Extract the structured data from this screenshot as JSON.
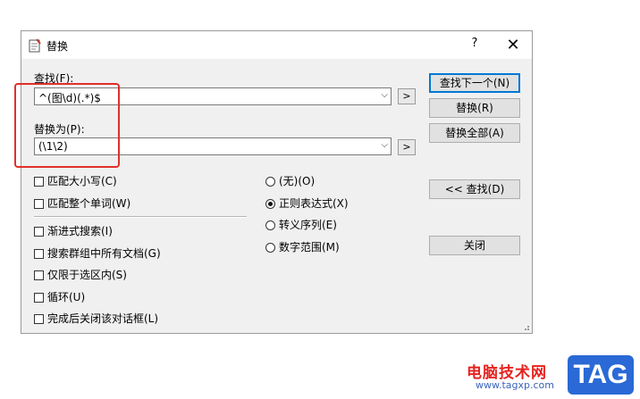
{
  "window": {
    "title": "替换",
    "help_label": "?",
    "close_label": "✕"
  },
  "find": {
    "label": "查找(F):",
    "value": "^(图\\d)(.*)$",
    "history_button": ">"
  },
  "replace": {
    "label": "替换为(P):",
    "value": "(\\1\\2)",
    "history_button": ">"
  },
  "buttons": {
    "find_next": "查找下一个(N)",
    "replace": "替换(R)",
    "replace_all": "替换全部(A)",
    "find": "<< 查找(D)",
    "close": "关闭"
  },
  "options": [
    {
      "label": "匹配大小写(C)",
      "checked": false
    },
    {
      "label": "匹配整个单词(W)",
      "checked": false
    },
    {
      "label": "渐进式搜索(I)",
      "checked": false
    },
    {
      "label": "搜索群组中所有文档(G)",
      "checked": false
    },
    {
      "label": "仅限于选区内(S)",
      "checked": false
    },
    {
      "label": "循环(U)",
      "checked": false
    },
    {
      "label": "完成后关闭该对话框(L)",
      "checked": false
    }
  ],
  "search_mode": [
    {
      "label": "(无)(O)",
      "selected": false
    },
    {
      "label": "正则表达式(X)",
      "selected": true
    },
    {
      "label": "转义序列(E)",
      "selected": false
    },
    {
      "label": "数字范围(M)",
      "selected": false
    }
  ],
  "watermark": {
    "site_name": "电脑技术网",
    "url": "www.tagxp.com",
    "tag": "TAG"
  },
  "colors": {
    "highlight_box": "#e0302a",
    "default_button_border": "#0078d7",
    "watermark_red": "#e5231f",
    "watermark_blue": "#2a69d6"
  }
}
